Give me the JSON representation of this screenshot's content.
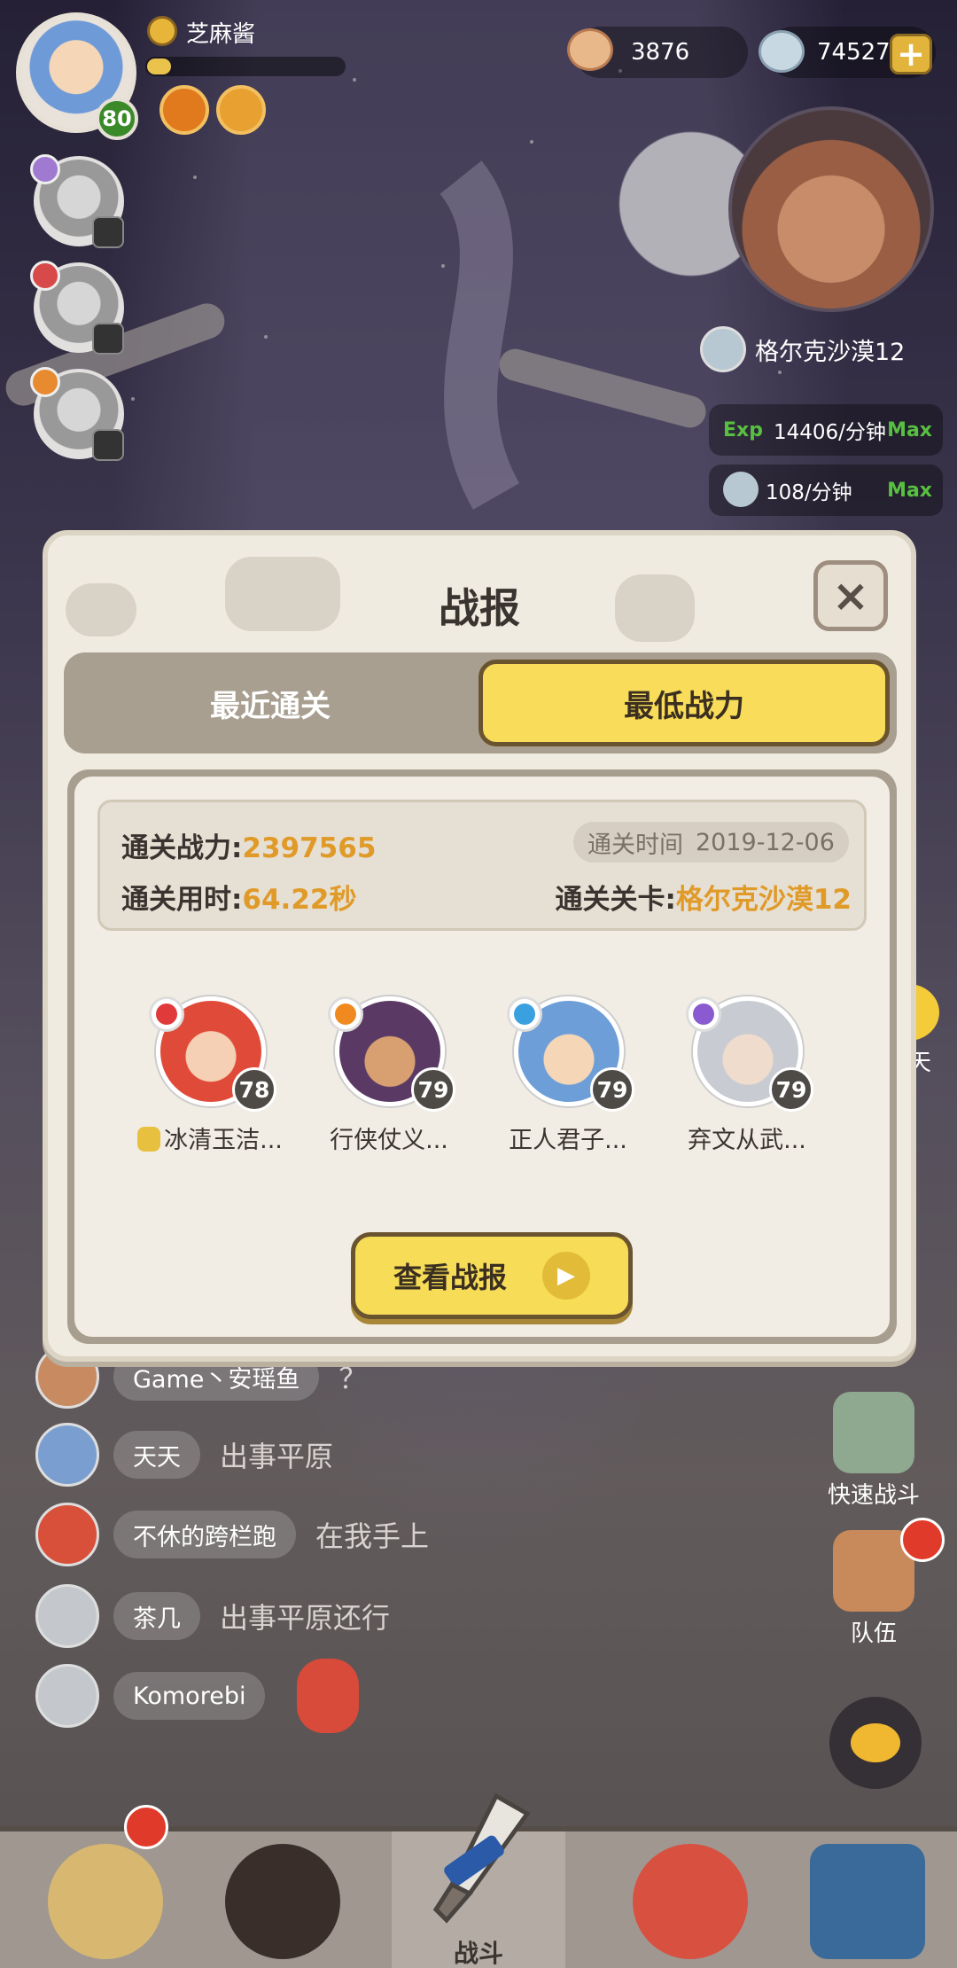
{
  "player": {
    "name": "芝麻酱",
    "level": "80",
    "exp_fraction": 0.12
  },
  "currency": {
    "shells": "3876",
    "pearls": "74527"
  },
  "stage_panel": {
    "name": "格尔克沙漠12",
    "exp_rate_tag": "Exp",
    "exp_rate": "14406/分钟",
    "exp_max": "Max",
    "pearl_rate": "108/分钟",
    "pearl_max": "Max"
  },
  "dialog": {
    "title": "战报",
    "close_label": "×",
    "tabs": [
      {
        "label": "最近通关",
        "active": false
      },
      {
        "label": "最低战力",
        "active": true
      }
    ],
    "stats": {
      "power_label": "通关战力:",
      "power_value": "2397565",
      "time_label": "通关时间",
      "time_value": "2019-12-06",
      "duration_label": "通关用时:",
      "duration_value": "64.22秒",
      "stage_label": "通关关卡:",
      "stage_value": "格尔克沙漠12"
    },
    "heroes": [
      {
        "name": "冰清玉洁...",
        "level": "78",
        "face_color": "#e04a38",
        "elem_color": "#e03a3a"
      },
      {
        "name": "行侠仗义...",
        "level": "79",
        "face_color": "#5a3a64",
        "elem_color": "#f08a20"
      },
      {
        "name": "正人君子...",
        "level": "79",
        "face_color": "#6e9ed8",
        "elem_color": "#3aa0e0"
      },
      {
        "name": "弃文从武...",
        "level": "79",
        "face_color": "#c8ccd2",
        "elem_color": "#8a5ad0"
      }
    ],
    "view_button": "查看战报"
  },
  "chat_float": "聊天",
  "chat": [
    {
      "name": "Game丶安瑶鱼",
      "msg": "？"
    },
    {
      "name": "天天",
      "msg": "出事平原"
    },
    {
      "name": "不休的跨栏跑",
      "msg": "在我手上"
    },
    {
      "name": "茶几",
      "msg": "出事平原还行"
    },
    {
      "name": "Komorebi",
      "msg": ""
    }
  ],
  "side_buttons": {
    "quick_battle": "快速战斗",
    "team": "队伍"
  },
  "bottom_nav": {
    "battle_label": "战斗"
  },
  "colors": {
    "accent_yellow": "#f7dc58",
    "value_orange": "#e09a28",
    "max_green": "#58c040"
  }
}
